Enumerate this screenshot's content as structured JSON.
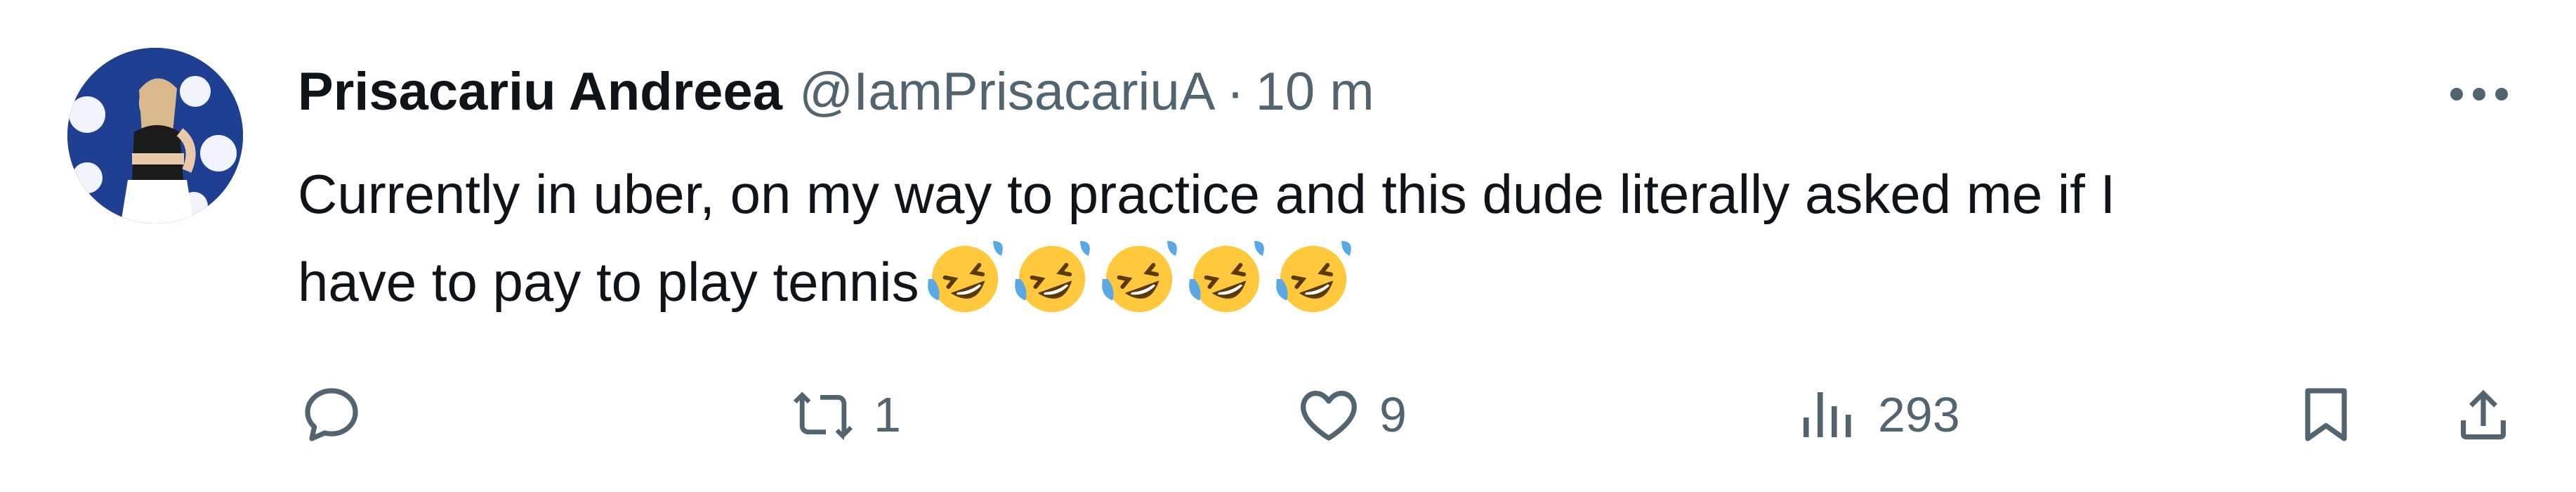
{
  "tweet": {
    "author": {
      "display_name": "Prisacariu Andreea",
      "handle": "@IamPrisacariuA",
      "separator": "·",
      "time": "10 m",
      "avatar_icon": "avatar-photo"
    },
    "text": {
      "line1": "Currently in uber, on my way to practice and this dude literally asked me if I",
      "line2": "have to pay to play tennis",
      "emoji": [
        "rolling-on-floor-laughing",
        "rolling-on-floor-laughing",
        "rolling-on-floor-laughing",
        "rolling-on-floor-laughing",
        "rolling-on-floor-laughing"
      ]
    },
    "actions": {
      "reply": {
        "icon": "reply-icon",
        "count": ""
      },
      "retweet": {
        "icon": "retweet-icon",
        "count": "1"
      },
      "like": {
        "icon": "heart-icon",
        "count": "9"
      },
      "views": {
        "icon": "views-icon",
        "count": "293"
      },
      "bookmark": {
        "icon": "bookmark-icon"
      },
      "share": {
        "icon": "share-icon"
      }
    },
    "more_icon": "more-icon"
  },
  "colors": {
    "text_primary": "#0f1419",
    "text_secondary": "#536471",
    "emoji_face": "#ffc83d",
    "emoji_tear": "#5aa9e6"
  }
}
